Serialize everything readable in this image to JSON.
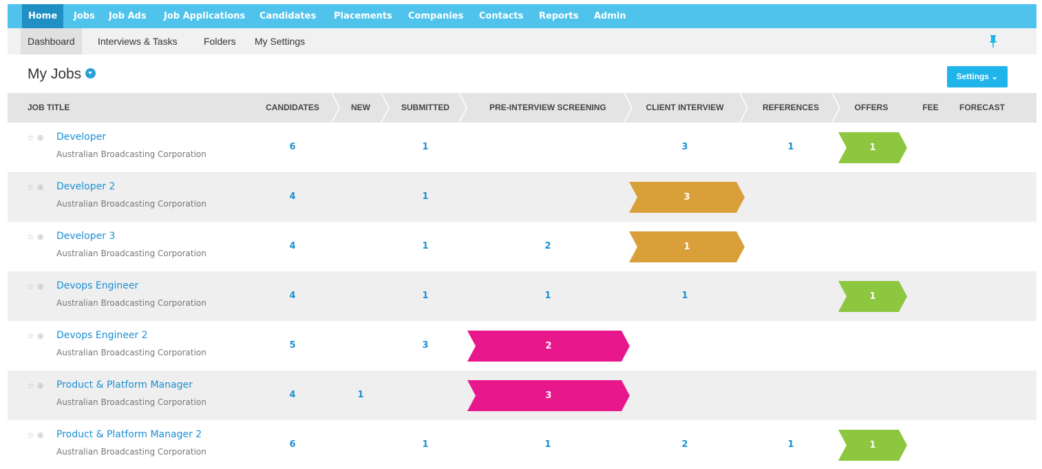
{
  "topnav": [
    "Home",
    "Jobs",
    "Job Ads",
    "Job Applications",
    "Candidates",
    "Placements",
    "Companies",
    "Contacts",
    "Reports",
    "Admin"
  ],
  "subnav": [
    "Dashboard",
    "Interviews & Tasks",
    "Folders",
    "My Settings"
  ],
  "heading": "My Jobs",
  "settings_label": "Settings ⌄",
  "columns": {
    "job_title": "JOB TITLE",
    "candidates": "CANDIDATES",
    "new": "NEW",
    "submitted": "SUBMITTED",
    "pre_interview": "PRE-INTERVIEW SCREENING",
    "client_interview": "CLIENT INTERVIEW",
    "references": "REFERENCES",
    "offers": "OFFERS",
    "fee": "FEE",
    "forecast": "FORECAST"
  },
  "colors": {
    "green": "#8dc63f",
    "orange": "#d9a03a",
    "pink": "#e8188c",
    "nav": "#4fc3eb",
    "link": "#1a8fd4"
  },
  "rows": [
    {
      "title": "Developer",
      "company": "Australian Broadcasting Corporation",
      "candidates": "6",
      "new": "",
      "submitted": "1",
      "pre_interview": "",
      "client_interview": "3",
      "references": "1",
      "offers": "1",
      "highlight": {
        "stage": "offers",
        "value": "1",
        "color": "green"
      }
    },
    {
      "title": "Developer 2",
      "company": "Australian Broadcasting Corporation",
      "candidates": "4",
      "new": "",
      "submitted": "1",
      "pre_interview": "",
      "client_interview": "3",
      "references": "",
      "offers": "",
      "highlight": {
        "stage": "client_interview",
        "value": "3",
        "color": "orange"
      }
    },
    {
      "title": "Developer 3",
      "company": "Australian Broadcasting Corporation",
      "candidates": "4",
      "new": "",
      "submitted": "1",
      "pre_interview": "2",
      "client_interview": "1",
      "references": "",
      "offers": "",
      "highlight": {
        "stage": "client_interview",
        "value": "1",
        "color": "orange"
      }
    },
    {
      "title": "Devops Engineer",
      "company": "Australian Broadcasting Corporation",
      "candidates": "4",
      "new": "",
      "submitted": "1",
      "pre_interview": "1",
      "client_interview": "1",
      "references": "",
      "offers": "1",
      "highlight": {
        "stage": "offers",
        "value": "1",
        "color": "green"
      }
    },
    {
      "title": "Devops Engineer 2",
      "company": "Australian Broadcasting Corporation",
      "candidates": "5",
      "new": "",
      "submitted": "3",
      "pre_interview": "2",
      "client_interview": "",
      "references": "",
      "offers": "",
      "highlight": {
        "stage": "pre_interview",
        "value": "2",
        "color": "pink"
      }
    },
    {
      "title": "Product & Platform Manager",
      "company": "Australian Broadcasting Corporation",
      "candidates": "4",
      "new": "1",
      "submitted": "",
      "pre_interview": "3",
      "client_interview": "",
      "references": "",
      "offers": "",
      "highlight": {
        "stage": "pre_interview",
        "value": "3",
        "color": "pink"
      }
    },
    {
      "title": "Product & Platform Manager 2",
      "company": "Australian Broadcasting Corporation",
      "candidates": "6",
      "new": "",
      "submitted": "1",
      "pre_interview": "1",
      "client_interview": "2",
      "references": "1",
      "offers": "1",
      "highlight": {
        "stage": "offers",
        "value": "1",
        "color": "green"
      }
    }
  ]
}
